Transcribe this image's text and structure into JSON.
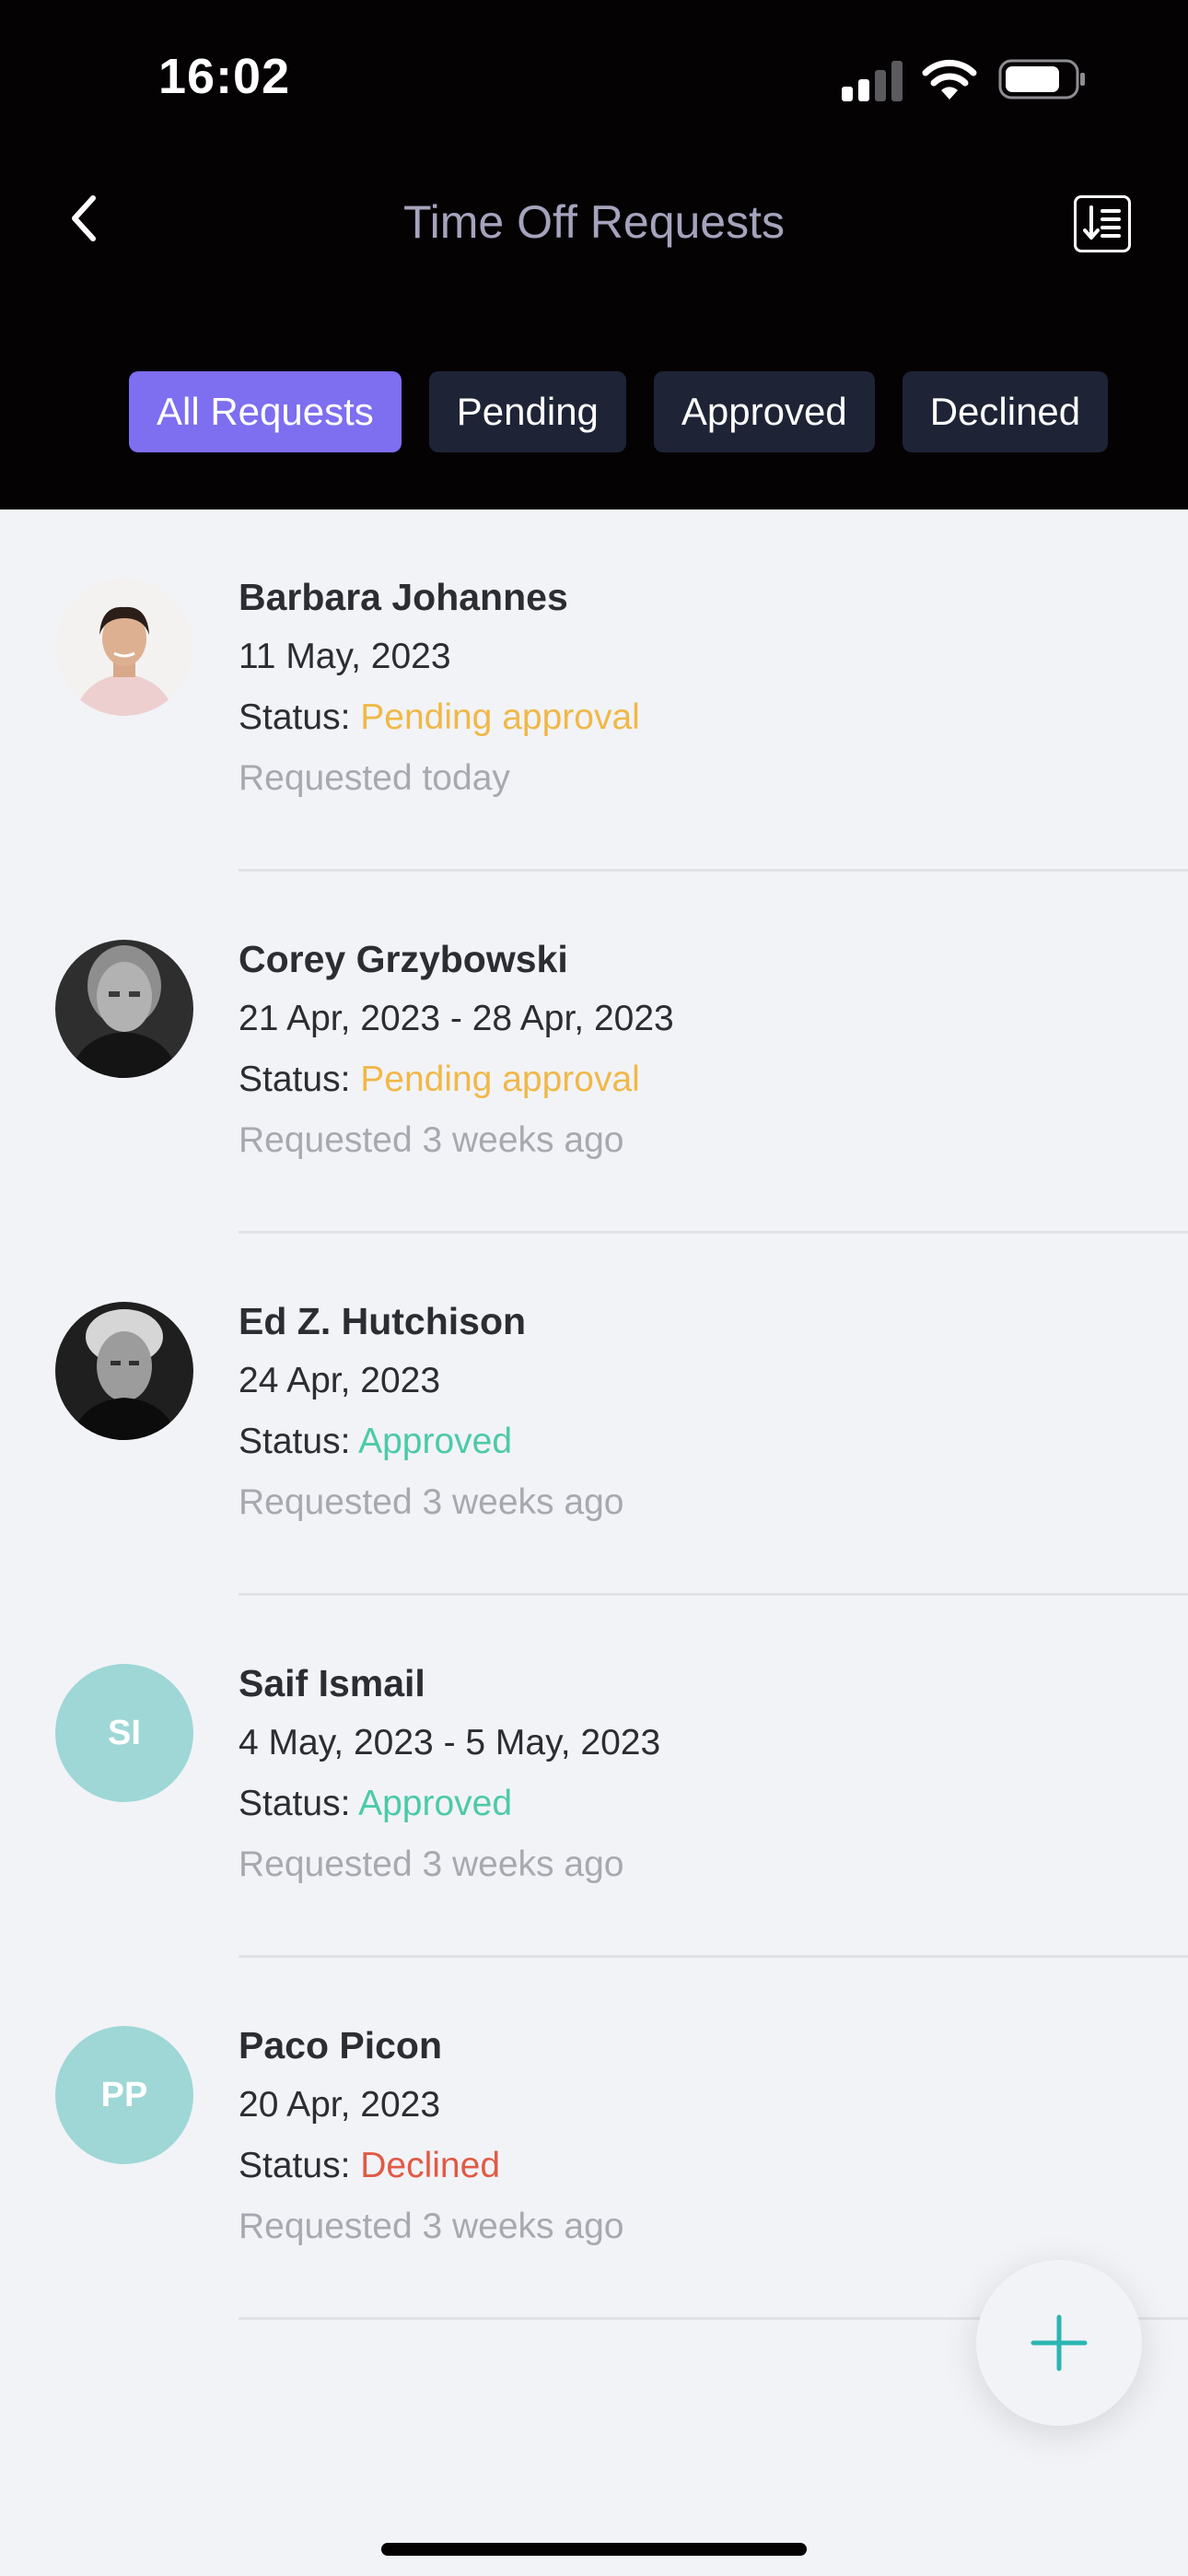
{
  "status_bar": {
    "time": "16:02"
  },
  "header": {
    "title": "Time Off Requests",
    "back_icon": "chevron-left-icon",
    "sort_icon": "sort-list-icon"
  },
  "tabs": [
    {
      "label": "All Requests",
      "active": true
    },
    {
      "label": "Pending",
      "active": false
    },
    {
      "label": "Approved",
      "active": false
    },
    {
      "label": "Declined",
      "active": false
    }
  ],
  "status_label": "Status:",
  "requests": [
    {
      "name": "Barbara Johannes",
      "dates": "11 May, 2023",
      "status": "Pending approval",
      "status_type": "pending",
      "requested": "Requested today",
      "avatar": "photo"
    },
    {
      "name": "Corey Grzybowski",
      "dates": "21 Apr, 2023 - 28 Apr, 2023",
      "status": "Pending approval",
      "status_type": "pending",
      "requested": "Requested 3 weeks ago",
      "avatar": "photo"
    },
    {
      "name": "Ed Z. Hutchison",
      "dates": "24 Apr, 2023",
      "status": "Approved",
      "status_type": "approved",
      "requested": "Requested 3 weeks ago",
      "avatar": "photo"
    },
    {
      "name": "Saif Ismail",
      "dates": "4 May, 2023 - 5 May, 2023",
      "status": "Approved",
      "status_type": "approved",
      "requested": "Requested 3 weeks ago",
      "initials": "SI"
    },
    {
      "name": "Paco Picon",
      "dates": "20 Apr, 2023",
      "status": "Declined",
      "status_type": "declined",
      "requested": "Requested 3 weeks ago",
      "initials": "PP"
    }
  ],
  "colors": {
    "accent": "#7e6ef0",
    "pending": "#f0b848",
    "approved": "#4ccaa8",
    "declined": "#e05a45",
    "initials_bg": "#9ed7d6",
    "fab_plus": "#2cb5b2"
  },
  "fab_icon": "plus-icon"
}
